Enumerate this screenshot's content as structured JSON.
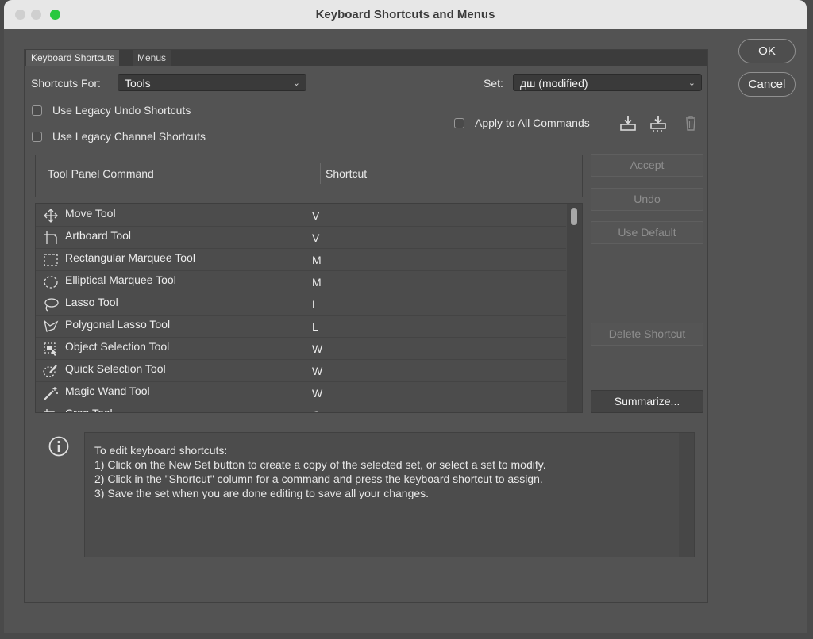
{
  "window": {
    "title": "Keyboard Shortcuts and Menus"
  },
  "tabs": [
    {
      "label": "Keyboard Shortcuts"
    },
    {
      "label": "Menus"
    }
  ],
  "shortcuts_for": {
    "label": "Shortcuts For:",
    "value": "Tools"
  },
  "set": {
    "label": "Set:",
    "value": "дш (modified)"
  },
  "options": {
    "legacy_undo": "Use Legacy Undo Shortcuts",
    "legacy_channel": "Use Legacy Channel Shortcuts",
    "apply_all": "Apply to All Commands"
  },
  "icons": {
    "save_set": "save-set-icon",
    "new_set": "new-set-icon",
    "delete_set": "trash-icon"
  },
  "table": {
    "col_command": "Tool Panel Command",
    "col_shortcut": "Shortcut",
    "rows": [
      {
        "name": "Move Tool",
        "key": "V",
        "icon": "move-icon"
      },
      {
        "name": "Artboard Tool",
        "key": "V",
        "icon": "artboard-icon"
      },
      {
        "name": "Rectangular Marquee Tool",
        "key": "M",
        "icon": "rect-marquee-icon"
      },
      {
        "name": "Elliptical Marquee Tool",
        "key": "M",
        "icon": "ellipse-marquee-icon"
      },
      {
        "name": "Lasso Tool",
        "key": "L",
        "icon": "lasso-icon"
      },
      {
        "name": "Polygonal Lasso Tool",
        "key": "L",
        "icon": "polygonal-lasso-icon"
      },
      {
        "name": "Object Selection Tool",
        "key": "W",
        "icon": "object-selection-icon"
      },
      {
        "name": "Quick Selection Tool",
        "key": "W",
        "icon": "quick-selection-icon"
      },
      {
        "name": "Magic Wand Tool",
        "key": "W",
        "icon": "magic-wand-icon"
      },
      {
        "name": "Crop Tool",
        "key": "C",
        "icon": "crop-icon"
      }
    ]
  },
  "buttons": {
    "accept": "Accept",
    "undo": "Undo",
    "use_default": "Use Default",
    "delete_shortcut": "Delete Shortcut",
    "summarize": "Summarize...",
    "ok": "OK",
    "cancel": "Cancel"
  },
  "info": {
    "lines": [
      "To edit keyboard shortcuts:",
      "1) Click on the New Set button to create a copy of the selected set, or select a set to modify.",
      "2) Click in the \"Shortcut\" column for a command and press the keyboard shortcut to assign.",
      "3) Save the set when you are done editing to save all your changes."
    ]
  },
  "colors": {
    "panel": "#535353",
    "titlebar": "#e7e7e7",
    "zoom_button": "#2ac840"
  }
}
